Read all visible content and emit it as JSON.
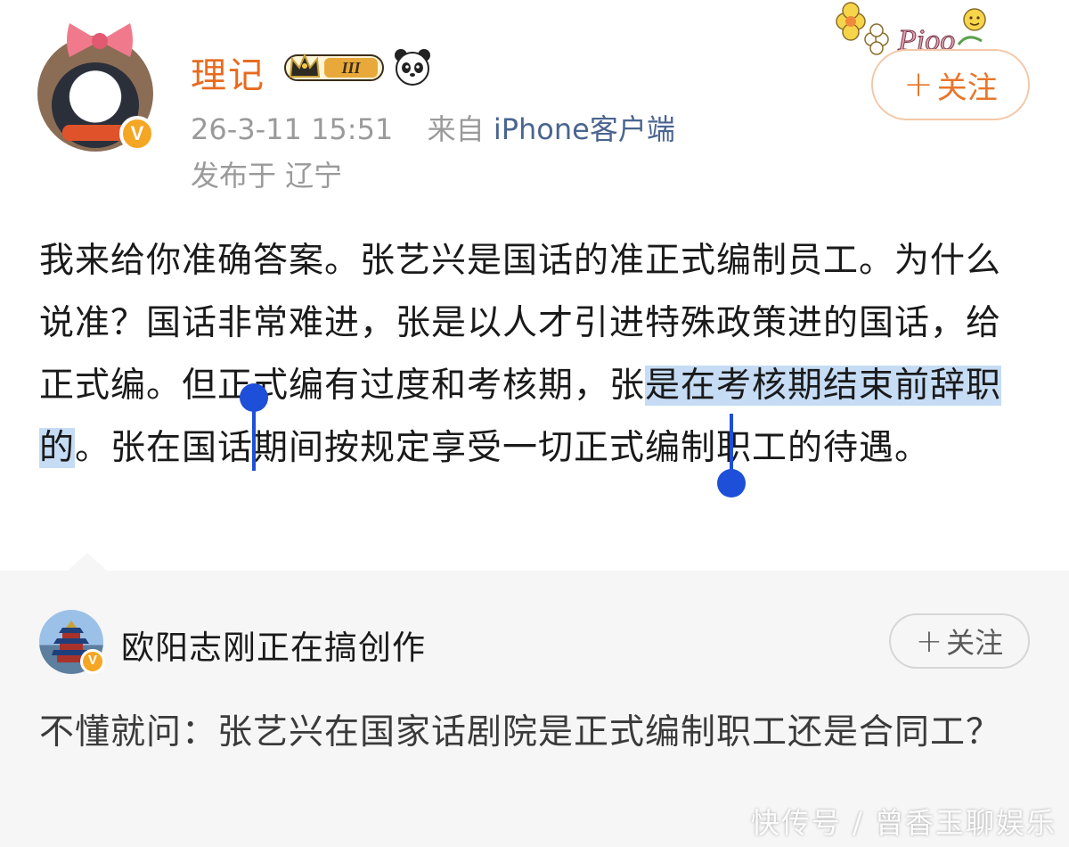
{
  "post": {
    "author": {
      "name": "理记",
      "vip_level": "III",
      "verified_badge": "V",
      "avatar_icon": "penguin-bow-avatar",
      "badge_icons": [
        "crown-vip-badge",
        "panda-icon"
      ]
    },
    "timestamp": "26-3-11 15:51",
    "source_prefix": "来自",
    "source_device": "iPhone客户端",
    "location": "发布于  辽宁",
    "follow_label": "关注",
    "sticker_text": "Pioo",
    "body": {
      "before_selection": "我来给你准确答案。张艺兴是国话的准正式编制员工。为什么说准？国话非常难进，张是以人才引进特殊政策进的国话，给正式编。但正式编有过度和考核期，张",
      "selected": "是在考核期结束前辞职的",
      "after_selection": "。张在国话期间按规定享受一切正式编制职工的待遇。"
    }
  },
  "repost": {
    "author": {
      "name": "欧阳志刚正在搞创作",
      "verified_badge": "V",
      "avatar_icon": "temple-of-heaven-avatar"
    },
    "follow_label": "关注",
    "body": "不懂就问：张艺兴在国家话剧院是正式编制职工还是合同工？"
  },
  "watermark": "快传号 / 曾香玉聊娱乐",
  "colors": {
    "username": "#e86b1f",
    "follow_accent": "#e8762a",
    "selection": "#c6dcf5",
    "selection_handle": "#1e4fd8",
    "repost_bg": "#f6f6f6",
    "meta_text": "#9a9a9a",
    "verified": "#f5a623"
  }
}
